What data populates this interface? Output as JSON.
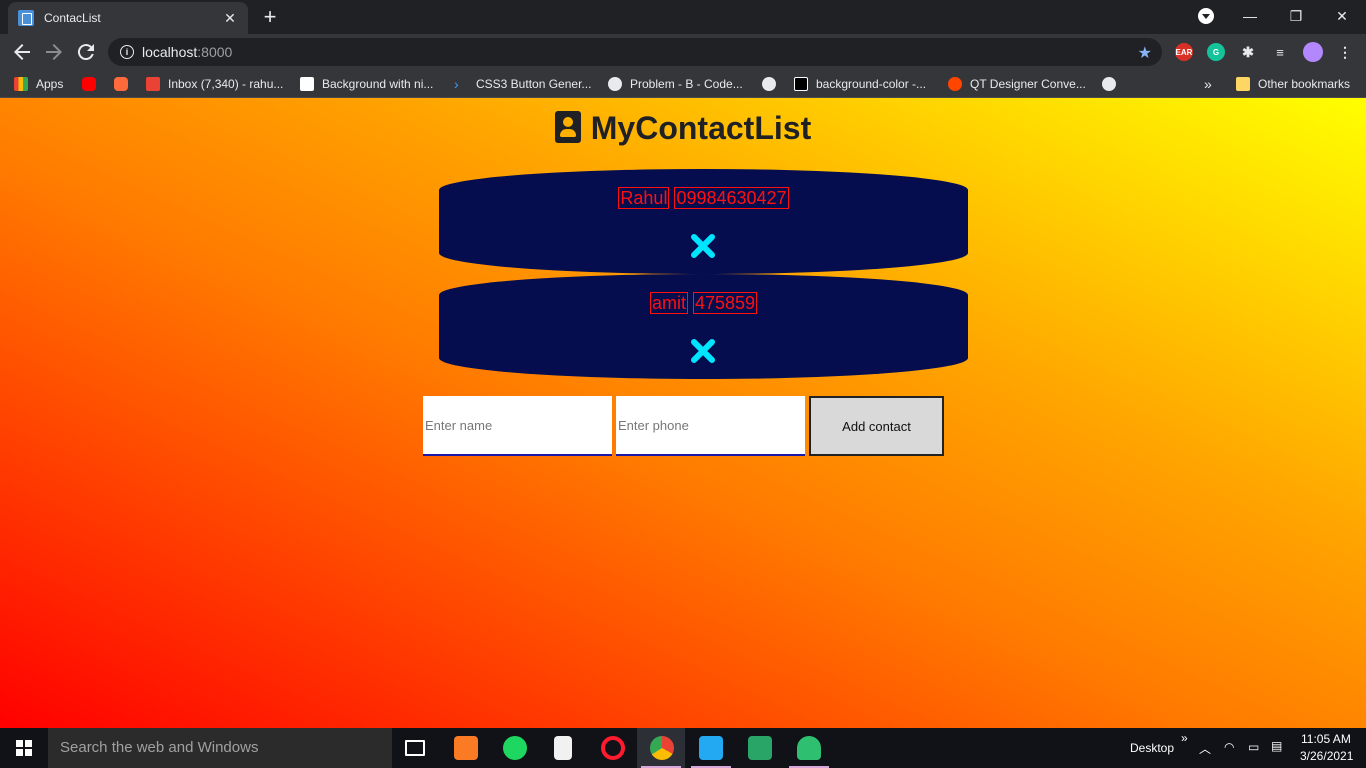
{
  "browser": {
    "tab_title": "ContacList",
    "tab_close": "✕",
    "new_tab": "+",
    "url_host": "localhost",
    "url_port": ":8000",
    "window_controls": {
      "minimize": "—",
      "restore": "❐",
      "close": "✕"
    }
  },
  "bookmarks": [
    {
      "label": "Apps",
      "icon": "apps-grid-icon",
      "color": "#ea4335"
    },
    {
      "label": "",
      "icon": "youtube-icon",
      "color": "#ff0000"
    },
    {
      "label": "",
      "icon": "extension-orange-icon",
      "color": "#ff6a3d"
    },
    {
      "label": "Inbox (7,340) - rahu...",
      "icon": "gmail-icon",
      "color": "#ea4335"
    },
    {
      "label": "Background with ni...",
      "icon": "v-logo-icon",
      "color": "#ffffff"
    },
    {
      "label": "CSS3 Button Gener...",
      "icon": "chevron-logo-icon",
      "color": "#3aa0ff"
    },
    {
      "label": "Problem - B - Code...",
      "icon": "globe-icon",
      "color": "#e8eaed"
    },
    {
      "label": "",
      "icon": "globe-icon",
      "color": "#e8eaed"
    },
    {
      "label": "background-color -...",
      "icon": "site-logo-icon",
      "color": "#000000"
    },
    {
      "label": "QT Designer Conve...",
      "icon": "reddit-icon",
      "color": "#ff4500"
    },
    {
      "label": "",
      "icon": "globe-icon",
      "color": "#e8eaed"
    }
  ],
  "bookmarks_more": "»",
  "other_bookmarks": "Other bookmarks",
  "app": {
    "title": "MyContactList",
    "contacts": [
      {
        "name": "Rahul",
        "phone": "09984630427"
      },
      {
        "name": "amit",
        "phone": "475859"
      }
    ],
    "name_placeholder": "Enter name",
    "phone_placeholder": "Enter phone",
    "add_label": "Add contact",
    "colors": {
      "card_bg": "#050d4f",
      "contact_text": "#ff1010",
      "delete_icon": "#00e5ff"
    }
  },
  "taskbar": {
    "search_placeholder": "Search the web and Windows",
    "desktop_label": "Desktop",
    "chevron": "»",
    "time": "11:05 AM",
    "date": "3/26/2021"
  }
}
